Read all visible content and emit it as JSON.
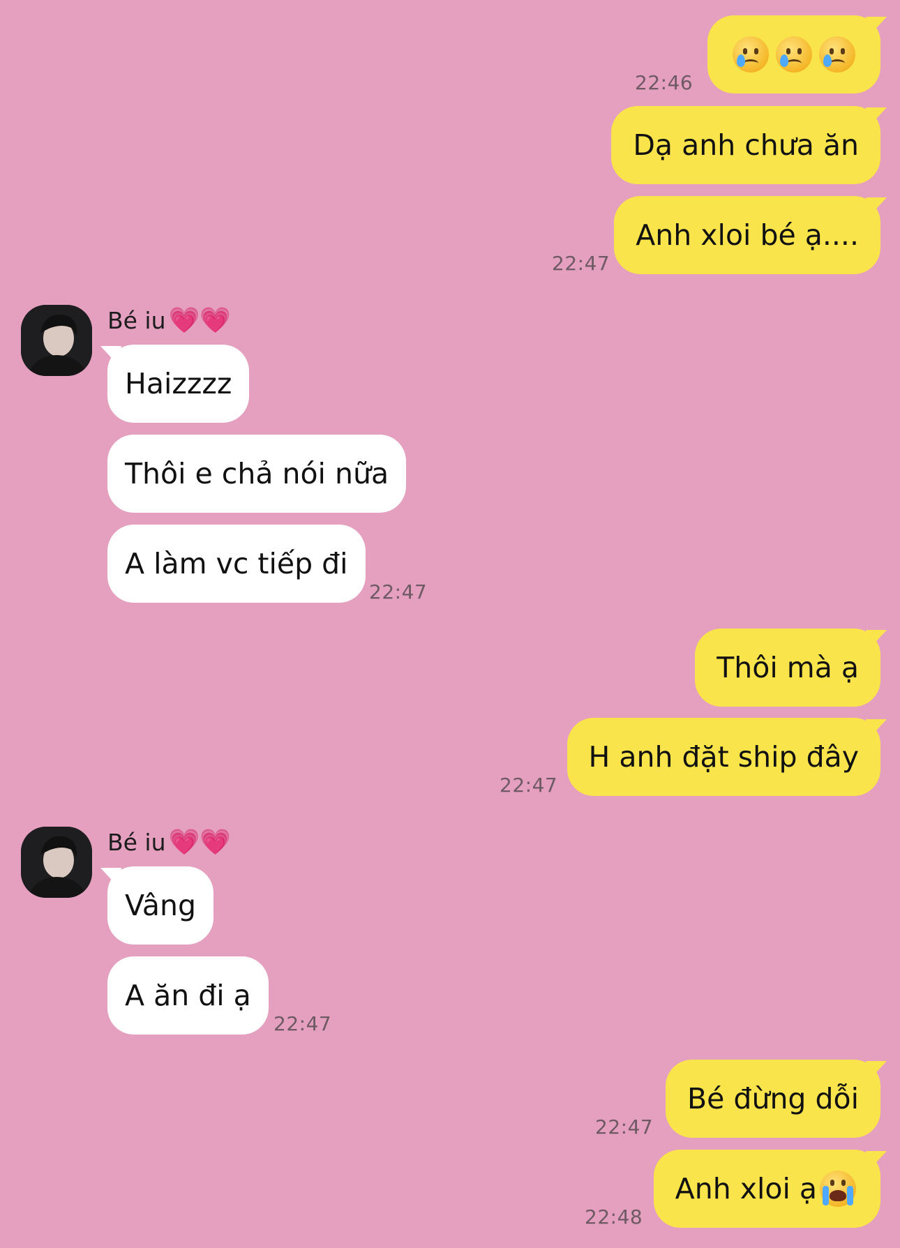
{
  "contact": {
    "name": "Bé iu",
    "name_hearts": "💗💗"
  },
  "messages": [
    {
      "sender": "me",
      "text": "",
      "emoji": "😢😢😢",
      "time": "22:46"
    },
    {
      "sender": "me",
      "text": "Dạ anh chưa ăn"
    },
    {
      "sender": "me",
      "text": "Anh xloi bé ạ....",
      "time": "22:47"
    },
    {
      "sender": "peer",
      "text": "Haizzzz"
    },
    {
      "sender": "peer",
      "text": "Thôi e chả nói nữa"
    },
    {
      "sender": "peer",
      "text": "A làm vc tiếp đi",
      "time": "22:47"
    },
    {
      "sender": "me",
      "text": "Thôi mà ạ"
    },
    {
      "sender": "me",
      "text": "H anh đặt ship đây",
      "time": "22:47"
    },
    {
      "sender": "peer",
      "text": "Vâng"
    },
    {
      "sender": "peer",
      "text": "A ăn đi ạ",
      "time": "22:47"
    },
    {
      "sender": "me",
      "text": "Bé đừng dỗi",
      "time": "22:47"
    },
    {
      "sender": "me",
      "text": "Anh xloi ạ",
      "emoji": "😭",
      "time": "22:48"
    }
  ],
  "colors": {
    "background": "#e59fbf",
    "my_bubble": "#f9e44b",
    "peer_bubble": "#ffffff"
  }
}
